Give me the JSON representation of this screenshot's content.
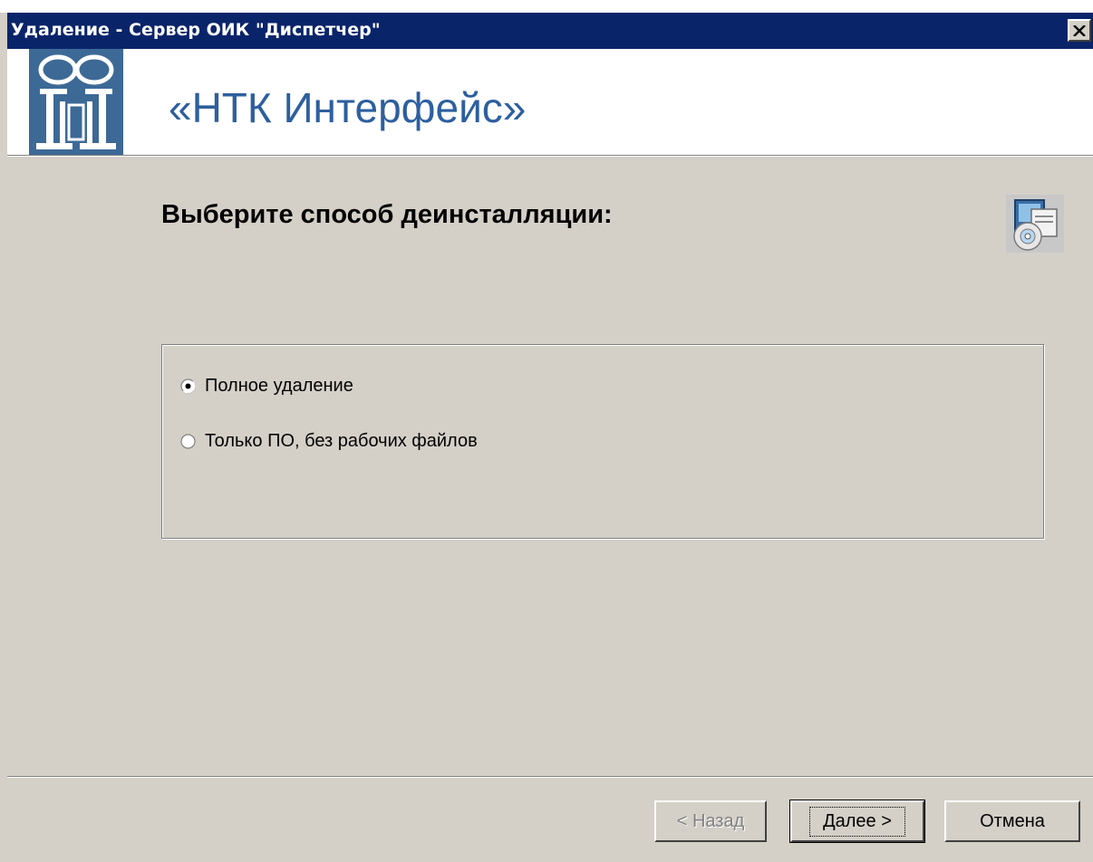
{
  "window": {
    "title": "Удаление - Сервер ОИК \"Диспетчер\"",
    "close_glyph": "✕"
  },
  "header": {
    "brand": "«НТК Интерфейс»",
    "logo_icon": "ntk-logo-icon",
    "colors": {
      "brand": "#2d5f9f",
      "logo_bg": "#3d6996",
      "titlebar": "#0a246a"
    }
  },
  "main": {
    "title": "Выберите способ деинсталляции:",
    "icon": "setup-disc-icon",
    "options": [
      {
        "label": "Полное удаление",
        "selected": true
      },
      {
        "label": "Только ПО, без рабочих файлов",
        "selected": false
      }
    ]
  },
  "footer": {
    "back_label": "< Назад",
    "next_label": "Далее >",
    "cancel_label": "Отмена",
    "back_enabled": false
  }
}
